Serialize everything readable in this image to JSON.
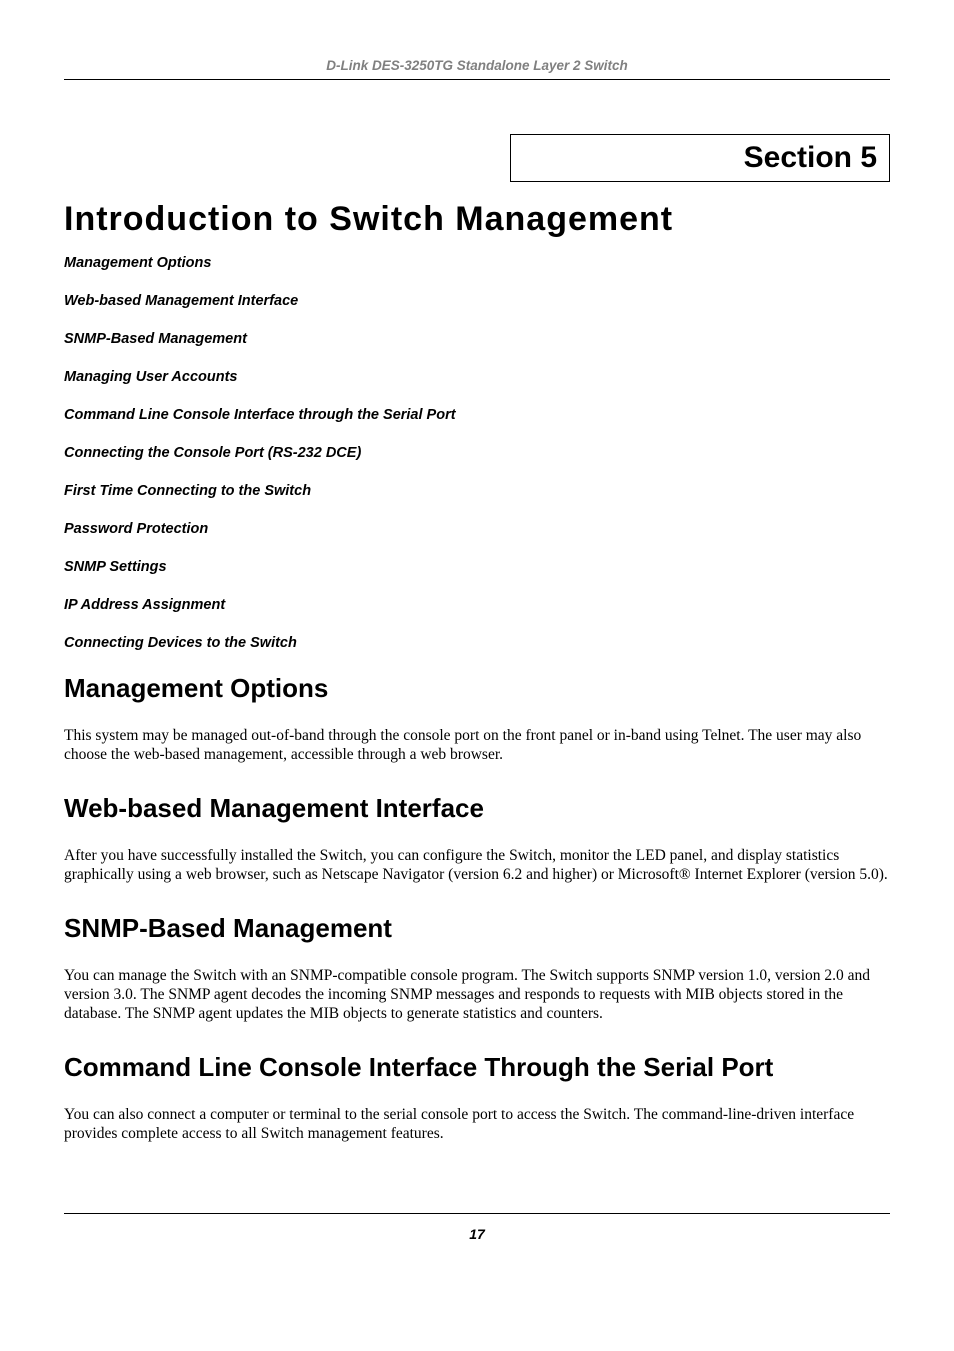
{
  "header": "D-Link DES-3250TG Standalone Layer 2 Switch",
  "section_label": "Section 5",
  "page_title": "Introduction to Switch Management",
  "toc": [
    "Management Options",
    "Web-based Management Interface",
    "SNMP-Based Management",
    "Managing User Accounts",
    "Command Line Console Interface through the Serial Port",
    "Connecting the Console Port (RS-232 DCE)",
    "First Time Connecting to the Switch",
    "Password Protection",
    "SNMP Settings",
    "IP Address Assignment",
    "Connecting Devices to the Switch"
  ],
  "sections": [
    {
      "heading": "Management Options",
      "body": "This system may be managed out-of-band through the console port on the front panel or in-band using Telnet. The user may also choose the web-based management, accessible through a web browser."
    },
    {
      "heading": "Web-based Management Interface",
      "body": "After you have successfully installed the Switch, you can configure the Switch, monitor the LED panel, and display statistics graphically using a web browser, such as Netscape Navigator (version 6.2 and higher) or Microsoft® Internet Explorer (version 5.0)."
    },
    {
      "heading": "SNMP-Based Management",
      "body": "You can manage the Switch with an SNMP-compatible console program. The Switch supports SNMP version 1.0, version 2.0 and version 3.0. The SNMP agent decodes the incoming SNMP messages and responds to requests with MIB objects stored in the database. The SNMP agent updates the MIB objects to generate statistics and counters."
    },
    {
      "heading": "Command Line Console Interface Through the Serial Port",
      "body": "You can also connect a computer or terminal to the serial console port to access the Switch. The command-line-driven interface provides complete access to all Switch management features."
    }
  ],
  "page_number": "17"
}
